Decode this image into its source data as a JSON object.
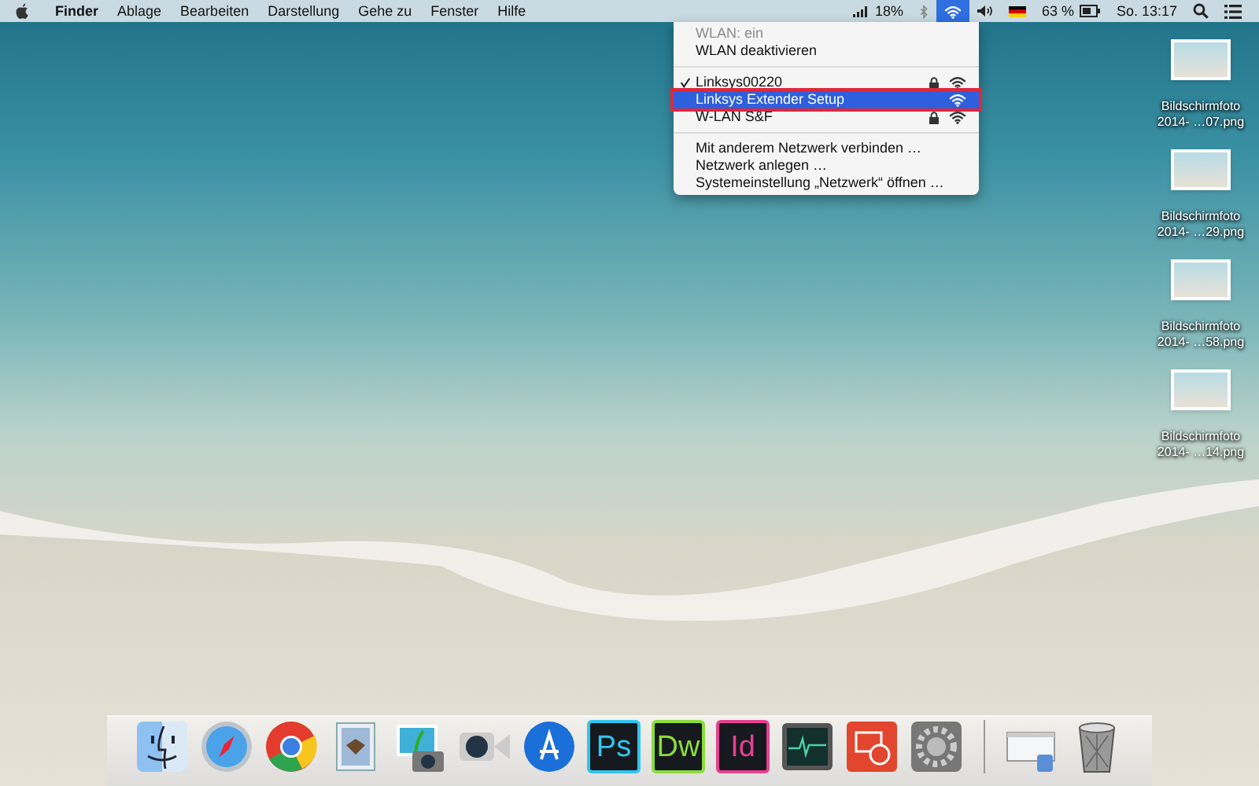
{
  "menu_bar": {
    "app_name": "Finder",
    "menus": [
      "Ablage",
      "Bearbeiten",
      "Darstellung",
      "Gehe zu",
      "Fenster",
      "Hilfe"
    ],
    "status": [
      {
        "kind": "signal",
        "label": "18%",
        "selected": false
      },
      {
        "kind": "bluetooth",
        "selected": false
      },
      {
        "kind": "wifi",
        "selected": true
      },
      {
        "kind": "volume",
        "selected": false
      },
      {
        "kind": "flag",
        "selected": false
      },
      {
        "kind": "battery",
        "label": "63 %",
        "selected": false
      },
      {
        "kind": "clock",
        "label": "So. 13:17",
        "selected": false
      },
      {
        "kind": "search",
        "selected": false
      },
      {
        "kind": "list",
        "selected": false
      }
    ]
  },
  "wifi_menu": {
    "status": "WLAN: ein",
    "toggle": "WLAN deaktivieren",
    "networks": [
      {
        "name": "Linksys00220",
        "checked": true,
        "locked": true,
        "selected": false
      },
      {
        "name": "Linksys Extender Setup",
        "checked": false,
        "locked": false,
        "selected": true
      },
      {
        "name": "W-LAN S&F",
        "checked": false,
        "locked": true,
        "selected": false
      }
    ],
    "actions": [
      "Mit anderem Netzwerk verbinden …",
      "Netzwerk anlegen …",
      "Systemeinstellung „Netzwerk“ öffnen …"
    ]
  },
  "desktop_files": [
    {
      "line_1": "Bildschirmfoto",
      "line_2": "2014- …07.png"
    },
    {
      "line_1": "Bildschirmfoto",
      "line_2": "2014- …29.png"
    },
    {
      "line_1": "Bildschirmfoto",
      "line_2": "2014- …58.png"
    },
    {
      "line_1": "Bildschirmfoto",
      "line_2": "2014- …14.png"
    }
  ],
  "dock": [
    {
      "kind": "finder"
    },
    {
      "kind": "compass"
    },
    {
      "kind": "browser"
    },
    {
      "kind": "mail"
    },
    {
      "kind": "photos"
    },
    {
      "kind": "camera"
    },
    {
      "kind": "store"
    },
    {
      "kind": "letter",
      "label": "Ps",
      "color": "#31c5f0"
    },
    {
      "kind": "letter",
      "label": "Dw",
      "color": "#8bdc3c"
    },
    {
      "kind": "letter",
      "label": "Id",
      "color": "#e4418f"
    },
    {
      "kind": "monitor"
    },
    {
      "kind": "remote"
    },
    {
      "kind": "gear"
    },
    {
      "kind": "separator"
    },
    {
      "kind": "window"
    },
    {
      "kind": "trash"
    }
  ]
}
